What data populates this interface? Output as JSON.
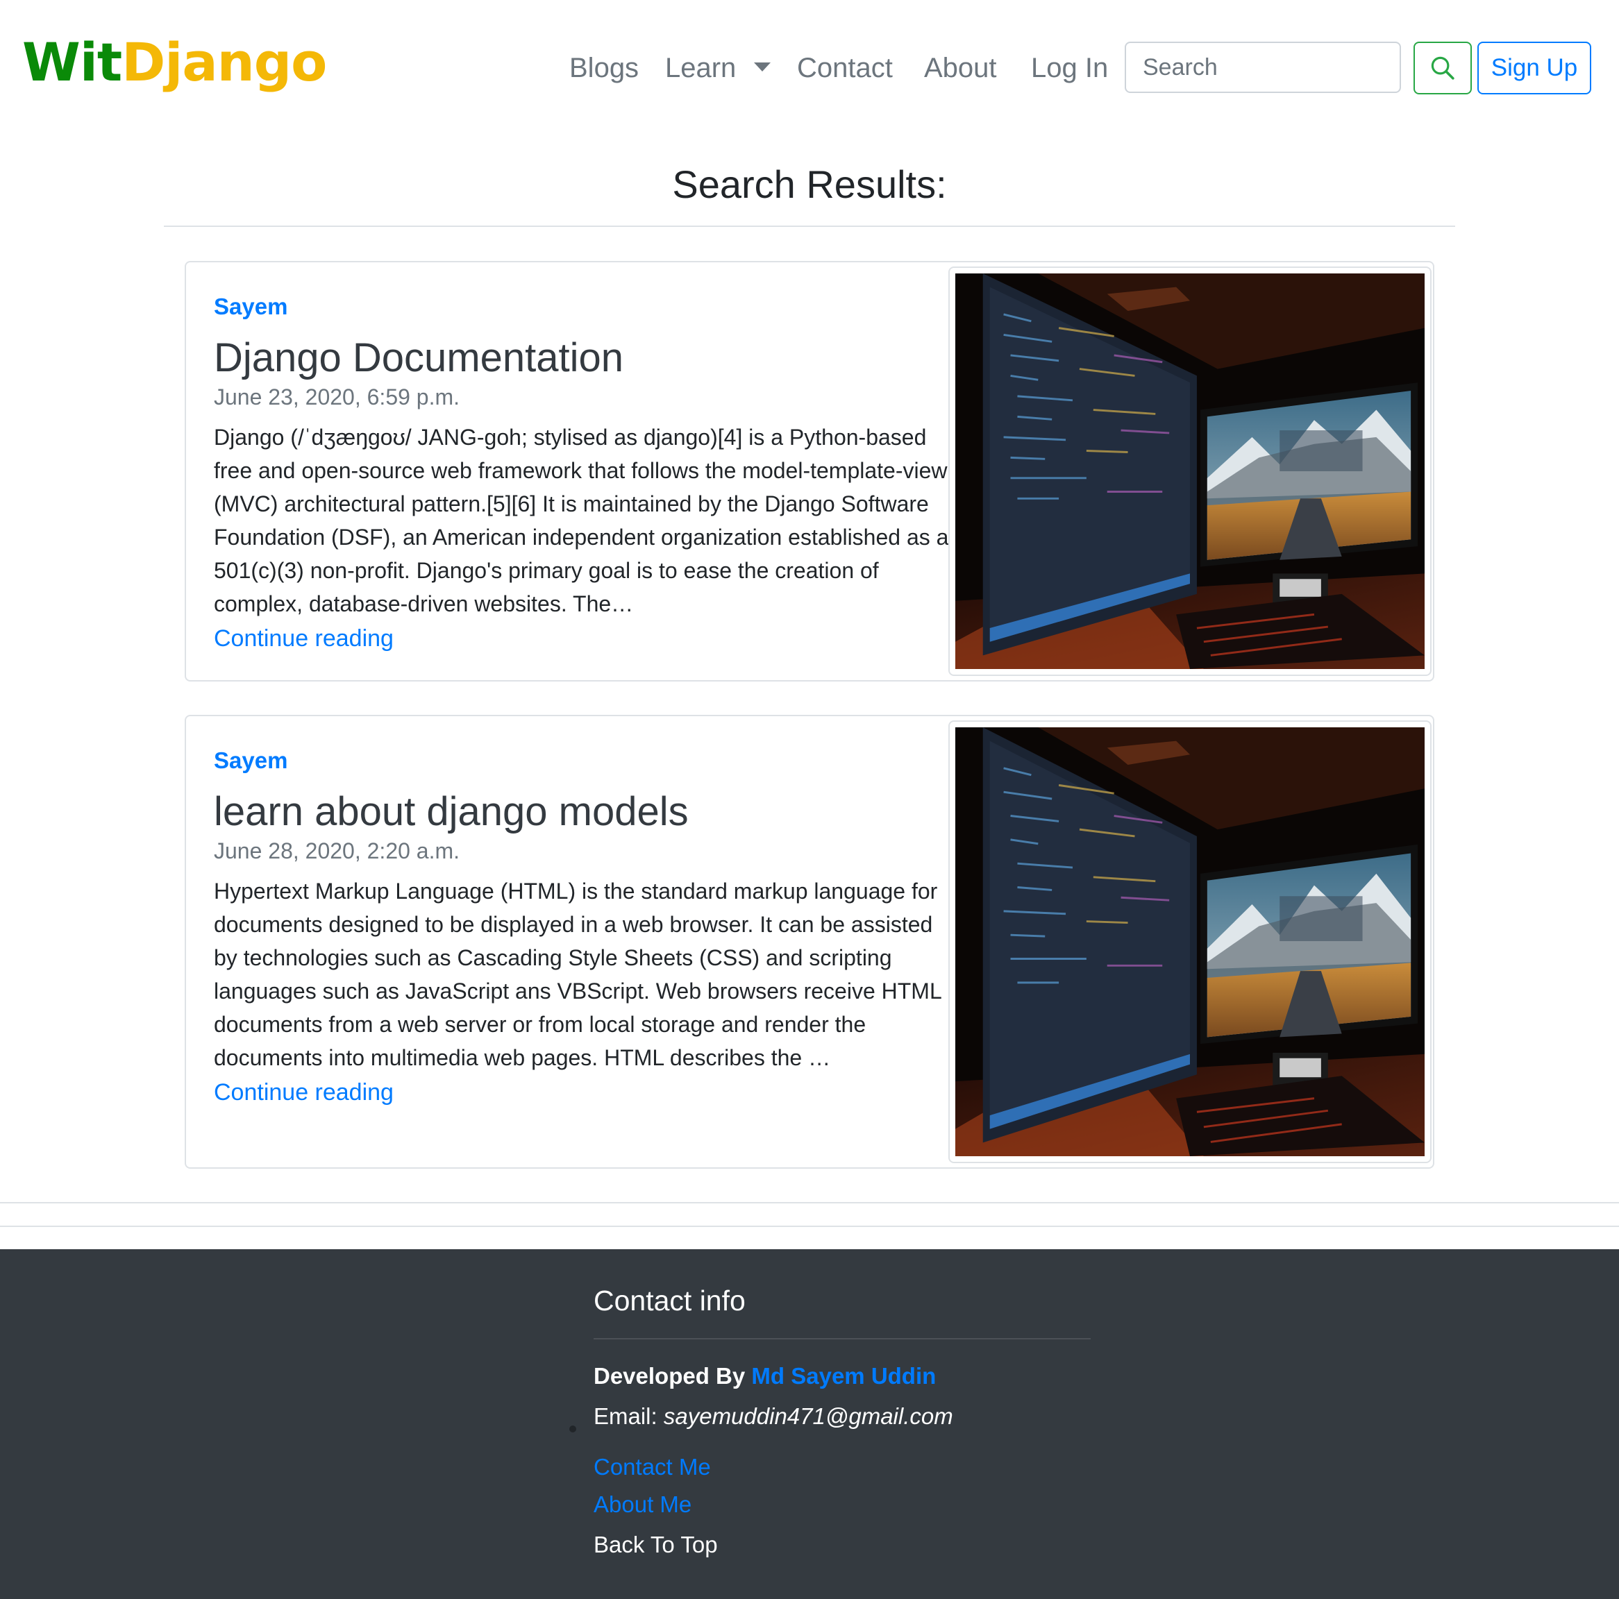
{
  "brand": {
    "part1": "Wit",
    "part2": "Django",
    "color_part1": "#0a8a08",
    "color_part2": "#f4b807"
  },
  "nav": {
    "blogs": "Blogs",
    "learn": "Learn",
    "contact": "Contact",
    "about": "About",
    "login": "Log In"
  },
  "search": {
    "placeholder": "Search",
    "value": "",
    "button_icon": "search-icon"
  },
  "signup": {
    "label": "Sign Up"
  },
  "results_heading": "Search Results:",
  "posts": [
    {
      "author": "Sayem",
      "title": "Django Documentation",
      "date": "June 23, 2020, 6:59 p.m.",
      "excerpt": "Django (/ˈdʒæŋɡoʊ/ JANG-goh; stylised as django)[4] is a Python-based free and open-source web framework that follows the model-template-view (MVC) architectural pattern.[5][6] It is maintained by the Django Software Foundation (DSF), an American independent organization established as a 501(c)(3) non-profit. Django's primary goal is to ease the creation of complex, database-driven websites. The…",
      "link": "Continue reading"
    },
    {
      "author": "Sayem",
      "title": "learn about django models",
      "date": "June 28, 2020, 2:20 a.m.",
      "excerpt": "Hypertext Markup Language (HTML) is the standard markup language for documents designed to be displayed in a web browser. It can be assisted by technologies such as Cascading Style Sheets (CSS) and scripting languages such as JavaScript ans VBScript. Web browsers receive HTML documents from a web server or from local storage and render the documents into multimedia web pages. HTML describes the …",
      "link": "Continue reading"
    }
  ],
  "footer": {
    "title": "Contact info",
    "developed_by": "Developed By",
    "developer": "Md Sayem Uddin",
    "email_label": "Email:",
    "email": "sayemuddin471@gmail.com",
    "contact_me": "Contact Me",
    "about_me": "About Me",
    "back_to_top": "Back To Top"
  },
  "colors": {
    "primary": "#007bff",
    "success": "#28a745",
    "muted": "#6c757d",
    "footer_bg": "#343a40"
  }
}
